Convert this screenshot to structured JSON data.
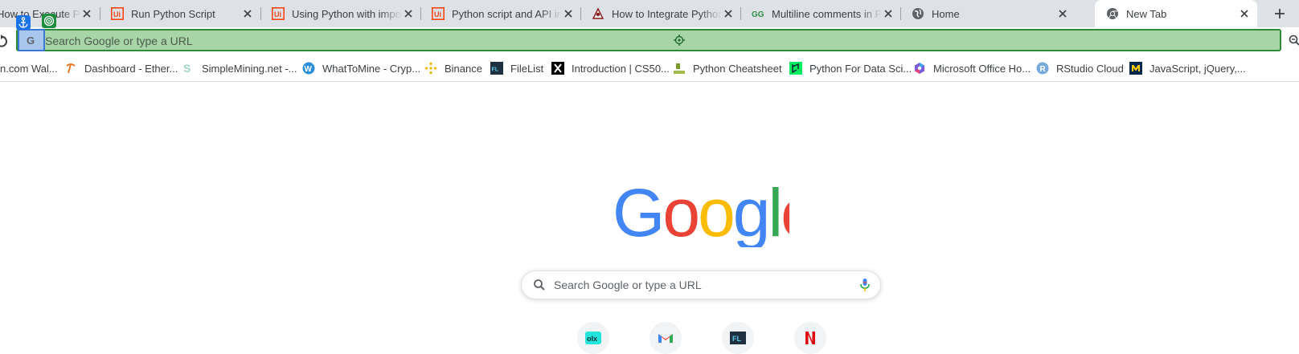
{
  "tabs": [
    {
      "title": "How to Execute Python",
      "favicon": "document-icon"
    },
    {
      "title": "Run Python Script",
      "favicon": "uipath-icon"
    },
    {
      "title": "Using Python with imports",
      "favicon": "uipath-icon"
    },
    {
      "title": "Python script and API integration",
      "favicon": "uipath-icon"
    },
    {
      "title": "How to Integrate Python with",
      "favicon": "integrate-icon"
    },
    {
      "title": "Multiline comments in Python",
      "favicon": "geeksforgeeks-icon"
    },
    {
      "title": "Home",
      "favicon": "globe-icon"
    },
    {
      "title": "New Tab",
      "favicon": "chrome-icon",
      "active": true
    }
  ],
  "omnibox": {
    "placeholder": "Search Google or type a URL"
  },
  "bookmarks": [
    {
      "label": "n.com Wal...",
      "icon": "wallet-icon"
    },
    {
      "label": "Dashboard - Ether...",
      "icon": "pickaxe-icon"
    },
    {
      "label": "SimpleMining.net -...",
      "icon": "simplemining-icon"
    },
    {
      "label": "WhatToMine - Cryp...",
      "icon": "whattomine-icon"
    },
    {
      "label": "Binance",
      "icon": "binance-icon"
    },
    {
      "label": "FileList",
      "icon": "filelist-icon"
    },
    {
      "label": "Introduction | CS50...",
      "icon": "cs50-icon"
    },
    {
      "label": "Python Cheatsheet",
      "icon": "cheatsheet-icon"
    },
    {
      "label": "Python For Data Sci...",
      "icon": "datacamp-icon"
    },
    {
      "label": "Microsoft Office Ho...",
      "icon": "office-icon"
    },
    {
      "label": "RStudio Cloud",
      "icon": "rstudio-icon"
    },
    {
      "label": "JavaScript, jQuery,...",
      "icon": "michigan-icon"
    }
  ],
  "ntp": {
    "logo": {
      "letters": [
        "G",
        "o",
        "o",
        "g",
        "l",
        "e"
      ],
      "colors": [
        "#4285f4",
        "#ea4335",
        "#fbbc05",
        "#4285f4",
        "#34a853",
        "#ea4335"
      ]
    },
    "search_placeholder": "Search Google or type a URL",
    "shortcuts": [
      {
        "icon": "olx-icon"
      },
      {
        "icon": "gmail-icon"
      },
      {
        "icon": "filelist-icon"
      },
      {
        "icon": "netflix-icon"
      }
    ]
  },
  "colors": {
    "omnibox_highlight": "#a8d5a8",
    "omnibox_border": "#2e8b3a",
    "anchor_badge": "#1a73e8",
    "target_badge": "#1e8e3e"
  }
}
